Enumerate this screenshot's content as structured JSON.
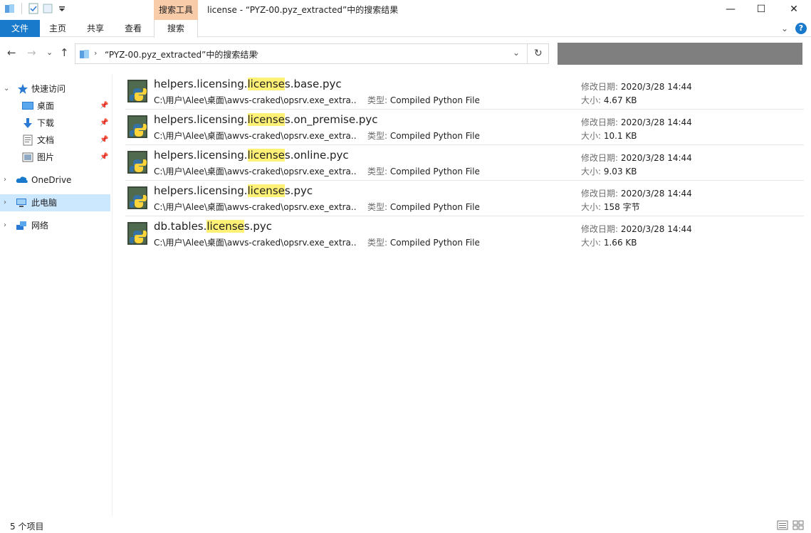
{
  "window": {
    "title": "license - “PYZ-00.pyz_extracted”中的搜索结果",
    "context_tab_header": "搜索工具",
    "minimize": "—",
    "maximize": "☐",
    "close": "✕"
  },
  "ribbon": {
    "tabs": [
      "文件",
      "主页",
      "共享",
      "查看",
      "搜索"
    ],
    "help": "?",
    "expand": "⌄"
  },
  "navbar": {
    "back": "←",
    "forward": "→",
    "recent": "⌄",
    "up": "↑",
    "address_path": "“PYZ-00.pyz_extracted”中的搜索结果",
    "chev": "›",
    "dropdown": "⌄",
    "refresh": "↻"
  },
  "sidebar": {
    "items": [
      {
        "label": "快速访问",
        "icon": "star-icon"
      },
      {
        "label": "桌面",
        "icon": "desktop-icon",
        "pinned": true
      },
      {
        "label": "下载",
        "icon": "download-icon",
        "pinned": true
      },
      {
        "label": "文档",
        "icon": "document-icon",
        "pinned": true
      },
      {
        "label": "图片",
        "icon": "picture-icon",
        "pinned": true
      },
      {
        "label": "OneDrive",
        "icon": "cloud-icon"
      },
      {
        "label": "此电脑",
        "icon": "computer-icon",
        "selected": true
      },
      {
        "label": "网络",
        "icon": "network-icon"
      }
    ],
    "pin": "📌"
  },
  "results": {
    "type_key": "类型: ",
    "date_key": "修改日期: ",
    "size_key": "大小: ",
    "items": [
      {
        "pre": "helpers.licensing.",
        "hl": "license",
        "post": "s.base.pyc",
        "path": "C:\\用户\\Alee\\桌面\\awvs-craked\\opsrv.exe_extra...",
        "type": "Compiled Python File",
        "date": "2020/3/28 14:44",
        "size": "4.67 KB"
      },
      {
        "pre": "helpers.licensing.",
        "hl": "license",
        "post": "s.on_premise.pyc",
        "path": "C:\\用户\\Alee\\桌面\\awvs-craked\\opsrv.exe_extra...",
        "type": "Compiled Python File",
        "date": "2020/3/28 14:44",
        "size": "10.1 KB"
      },
      {
        "pre": "helpers.licensing.",
        "hl": "license",
        "post": "s.online.pyc",
        "path": "C:\\用户\\Alee\\桌面\\awvs-craked\\opsrv.exe_extra...",
        "type": "Compiled Python File",
        "date": "2020/3/28 14:44",
        "size": "9.03 KB"
      },
      {
        "pre": "helpers.licensing.",
        "hl": "license",
        "post": "s.pyc",
        "path": "C:\\用户\\Alee\\桌面\\awvs-craked\\opsrv.exe_extra...",
        "type": "Compiled Python File",
        "date": "2020/3/28 14:44",
        "size": "158 字节"
      },
      {
        "pre": "db.tables.",
        "hl": "license",
        "post": "s.pyc",
        "path": "C:\\用户\\Alee\\桌面\\awvs-craked\\opsrv.exe_extra...",
        "type": "Compiled Python File",
        "date": "2020/3/28 14:44",
        "size": "1.66 KB"
      }
    ]
  },
  "status": {
    "count": "5 个项目"
  },
  "colors": {
    "accent": "#1979ca",
    "context_tab": "#f8cba9",
    "highlight": "#fff176",
    "selected_nav": "#cce8ff"
  }
}
